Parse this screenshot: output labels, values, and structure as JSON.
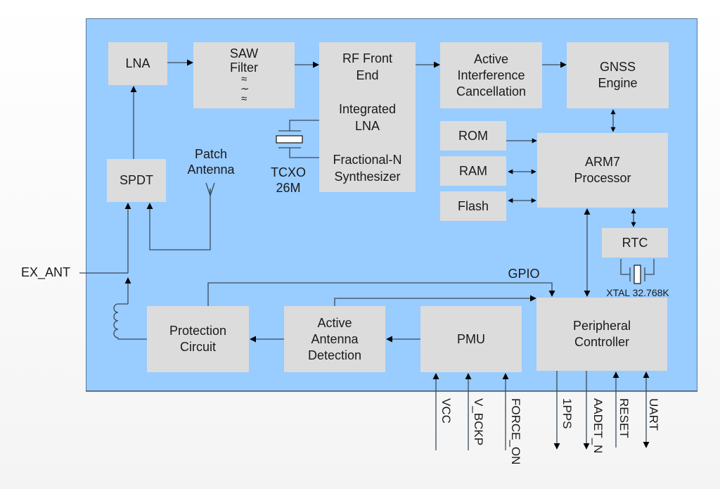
{
  "diagram": {
    "type": "block-diagram",
    "title": "",
    "colors": {
      "module_background": "#99ccff",
      "block_fill": "#dcdcdc",
      "wire": "#3b4a5a",
      "arrow": "#000000"
    },
    "blocks": {
      "lna": [
        "LNA"
      ],
      "saw_filter": [
        "SAW",
        "Filter"
      ],
      "saw_symbol": [
        "≈",
        "∼",
        "≈"
      ],
      "rf_front_end": [
        "RF Front",
        "End",
        "",
        "Integrated",
        "LNA",
        "",
        "Fractional-N",
        "Synthesizer"
      ],
      "aic": [
        "Active",
        "Interference",
        "Cancellation"
      ],
      "gnss_engine": [
        "GNSS",
        "Engine"
      ],
      "rom": [
        "ROM"
      ],
      "ram": [
        "RAM"
      ],
      "flash": [
        "Flash"
      ],
      "arm7": [
        "ARM7",
        "Processor"
      ],
      "rtc": [
        "RTC"
      ],
      "spdt": [
        "SPDT"
      ],
      "protection": [
        "Protection",
        "Circuit"
      ],
      "aad": [
        "Active",
        "Antenna",
        "Detection"
      ],
      "pmu": [
        "PMU"
      ],
      "peripheral": [
        "Peripheral",
        "Controller"
      ]
    },
    "labels": {
      "patch_antenna": [
        "Patch",
        "Antenna"
      ],
      "tcxo": [
        "TCXO",
        "26M"
      ],
      "xtal": "XTAL 32.768K",
      "gpio": "GPIO",
      "ex_ant": "EX_ANT"
    },
    "pins": [
      {
        "name": "VCC",
        "direction": "in"
      },
      {
        "name": "V_BCKP",
        "direction": "in"
      },
      {
        "name": "FORCE_ON",
        "direction": "in"
      },
      {
        "name": "1PPS",
        "direction": "out"
      },
      {
        "name": "AADET_N",
        "direction": "out"
      },
      {
        "name": "RESET",
        "direction": "in"
      },
      {
        "name": "UART",
        "direction": "bidirectional"
      }
    ],
    "connections": [
      {
        "from": "LNA",
        "to": "SAW Filter"
      },
      {
        "from": "SAW Filter",
        "to": "RF Front End"
      },
      {
        "from": "RF Front End",
        "to": "Active Interference Cancellation"
      },
      {
        "from": "Active Interference Cancellation",
        "to": "GNSS Engine"
      },
      {
        "from": "GNSS Engine",
        "to": "ARM7 Processor",
        "bidirectional": true
      },
      {
        "from": "ROM",
        "to": "ARM7 Processor"
      },
      {
        "from": "RAM",
        "to": "ARM7 Processor",
        "bidirectional": true
      },
      {
        "from": "Flash",
        "to": "ARM7 Processor",
        "bidirectional": true
      },
      {
        "from": "ARM7 Processor",
        "to": "RTC",
        "bidirectional": true
      },
      {
        "from": "ARM7 Processor",
        "to": "Peripheral Controller",
        "bidirectional": true
      },
      {
        "from": "SPDT",
        "to": "LNA"
      },
      {
        "from": "Patch Antenna",
        "to": "SPDT"
      },
      {
        "from": "EX_ANT",
        "to": "SPDT"
      },
      {
        "from": "Protection Circuit",
        "to": "Peripheral Controller",
        "label": "GPIO"
      },
      {
        "from": "Active Antenna Detection",
        "to": "Peripheral Controller"
      },
      {
        "from": "Active Antenna Detection",
        "to": "Protection Circuit"
      },
      {
        "from": "PMU",
        "to": "Active Antenna Detection"
      },
      {
        "from": "TCXO 26M",
        "to": "RF Front End"
      },
      {
        "from": "XTAL 32.768K",
        "to": "RTC"
      }
    ]
  }
}
